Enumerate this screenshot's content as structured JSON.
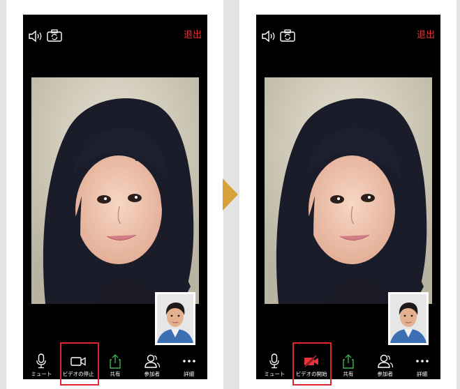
{
  "screens": [
    {
      "leave_label": "退出",
      "speaker_icon": "speaker-icon",
      "switch_icon": "camera-switch-icon",
      "toolbar": [
        {
          "label": "ミュート",
          "icon": "microphone-icon"
        },
        {
          "label": "ビデオの停止",
          "icon": "video-camera-icon"
        },
        {
          "label": "共有",
          "icon": "share-icon"
        },
        {
          "label": "参加者",
          "icon": "participants-icon"
        },
        {
          "label": "詳細",
          "icon": "more-icon"
        }
      ],
      "video_state": "on"
    },
    {
      "leave_label": "退出",
      "speaker_icon": "speaker-icon",
      "switch_icon": "camera-switch-icon",
      "toolbar": [
        {
          "label": "ミュート",
          "icon": "microphone-icon"
        },
        {
          "label": "ビデオの開始",
          "icon": "video-camera-off-icon"
        },
        {
          "label": "共有",
          "icon": "share-icon"
        },
        {
          "label": "参加者",
          "icon": "participants-icon"
        },
        {
          "label": "詳細",
          "icon": "more-icon"
        }
      ],
      "video_state": "off"
    }
  ],
  "colors": {
    "leave": "#e8333a",
    "share": "#3bb54a",
    "video_off": "#e8333a",
    "highlight": "#e0242b",
    "arrow": "#d8a23a"
  }
}
